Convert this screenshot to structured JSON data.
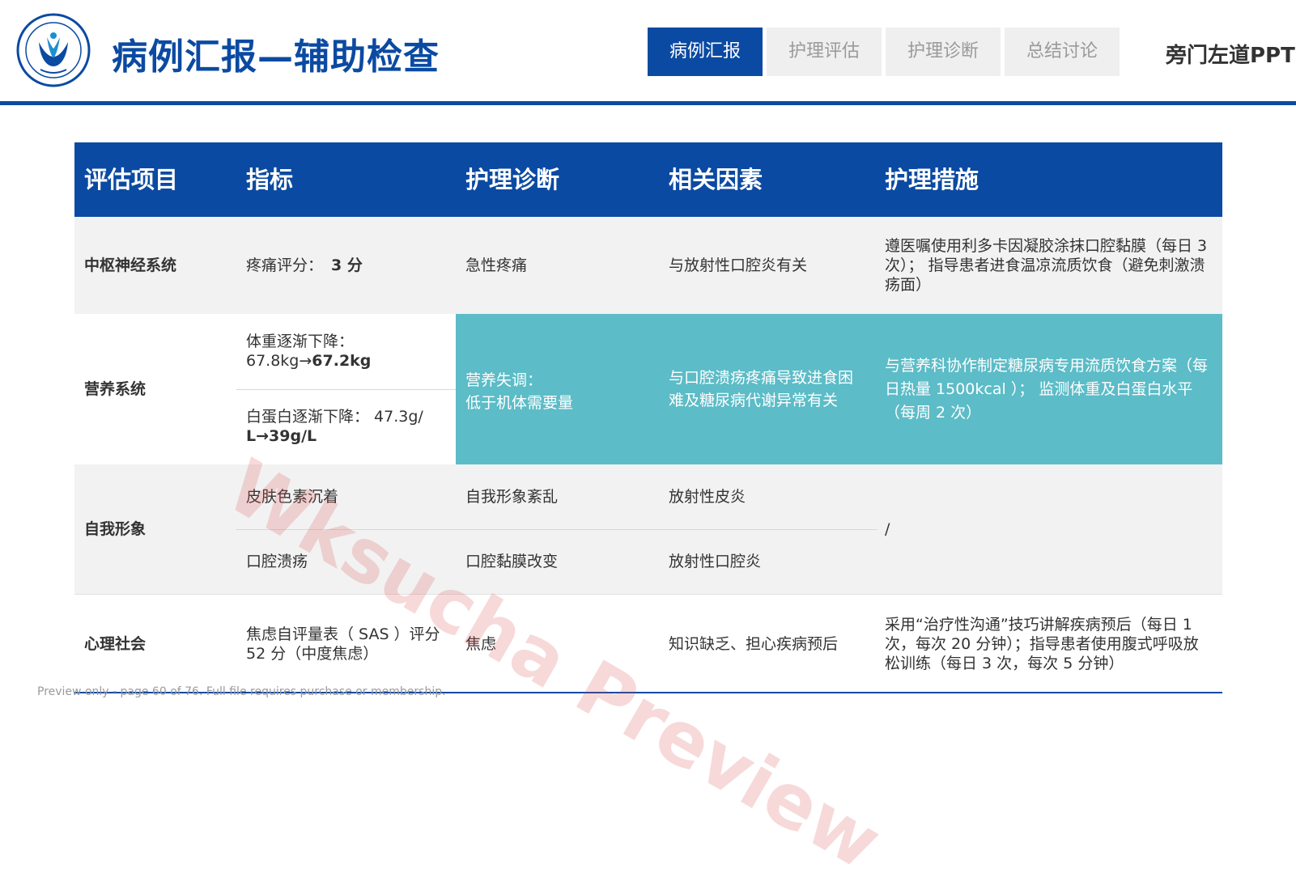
{
  "header": {
    "title": "病例汇报—辅助检查",
    "tabs": [
      "病例汇报",
      "护理评估",
      "护理诊断",
      "总结讨论"
    ],
    "active_tab": 0,
    "brand": "旁门左道PPT"
  },
  "table": {
    "headers": [
      "评估项目",
      "指标",
      "护理诊断",
      "相关因素",
      "护理措施"
    ],
    "rows": {
      "r1": {
        "item": "中枢神经系统",
        "indicator_label": "疼痛评分：",
        "indicator_value": "3 分",
        "diagnosis": "急性疼痛",
        "factor": "与放射性口腔炎有关",
        "measure": "遵医嘱使用利多卡因凝胶涂抹口腔黏膜（每日 3 次）； 指导患者进食温凉流质饮食（避免刺激溃疡面）"
      },
      "r2": {
        "item": "营养系统",
        "indicator1_label": "体重逐渐下降：",
        "indicator1_from": "67.8kg→",
        "indicator1_to": "67.2kg",
        "indicator2_label": "白蛋白逐渐下降： 47.3g/",
        "indicator2_to": "L→39g/L",
        "diagnosis_line1": "营养失调：",
        "diagnosis_line2": "低于机体需要量",
        "factor": "与口腔溃疡疼痛导致进食困难及糖尿病代谢异常有关",
        "measure": "与营养科协作制定糖尿病专用流质饮食方案（每日热量 1500kcal ）； 监测体重及白蛋白水平（每周 2 次）"
      },
      "r3": {
        "item": "自我形象",
        "indicator1": "皮肤色素沉着",
        "diagnosis1": "自我形象紊乱",
        "factor1": "放射性皮炎",
        "indicator2": "口腔溃疡",
        "diagnosis2": "口腔黏膜改变",
        "factor2": "放射性口腔炎",
        "measure": "/"
      },
      "r4": {
        "item": "心理社会",
        "indicator": "焦虑自评量表（ SAS ）评分 52 分（中度焦虑）",
        "diagnosis": "焦虑",
        "factor": "知识缺乏、担心疾病预后",
        "measure": "采用“治疗性沟通”技巧讲解疾病预后（每日 1 次，每次 20 分钟）；指导患者使用腹式呼吸放松训练（每日 3 次，每次 5 分钟）"
      }
    }
  },
  "footer": {
    "preview_note": "Preview only - page 60 of 76. Full file requires purchase or membership.",
    "watermark": "Wksucha Preview"
  },
  "colors": {
    "primary": "#0b4aa2",
    "teal": "#5cbcc7",
    "row_gray": "#f2f2f2"
  }
}
